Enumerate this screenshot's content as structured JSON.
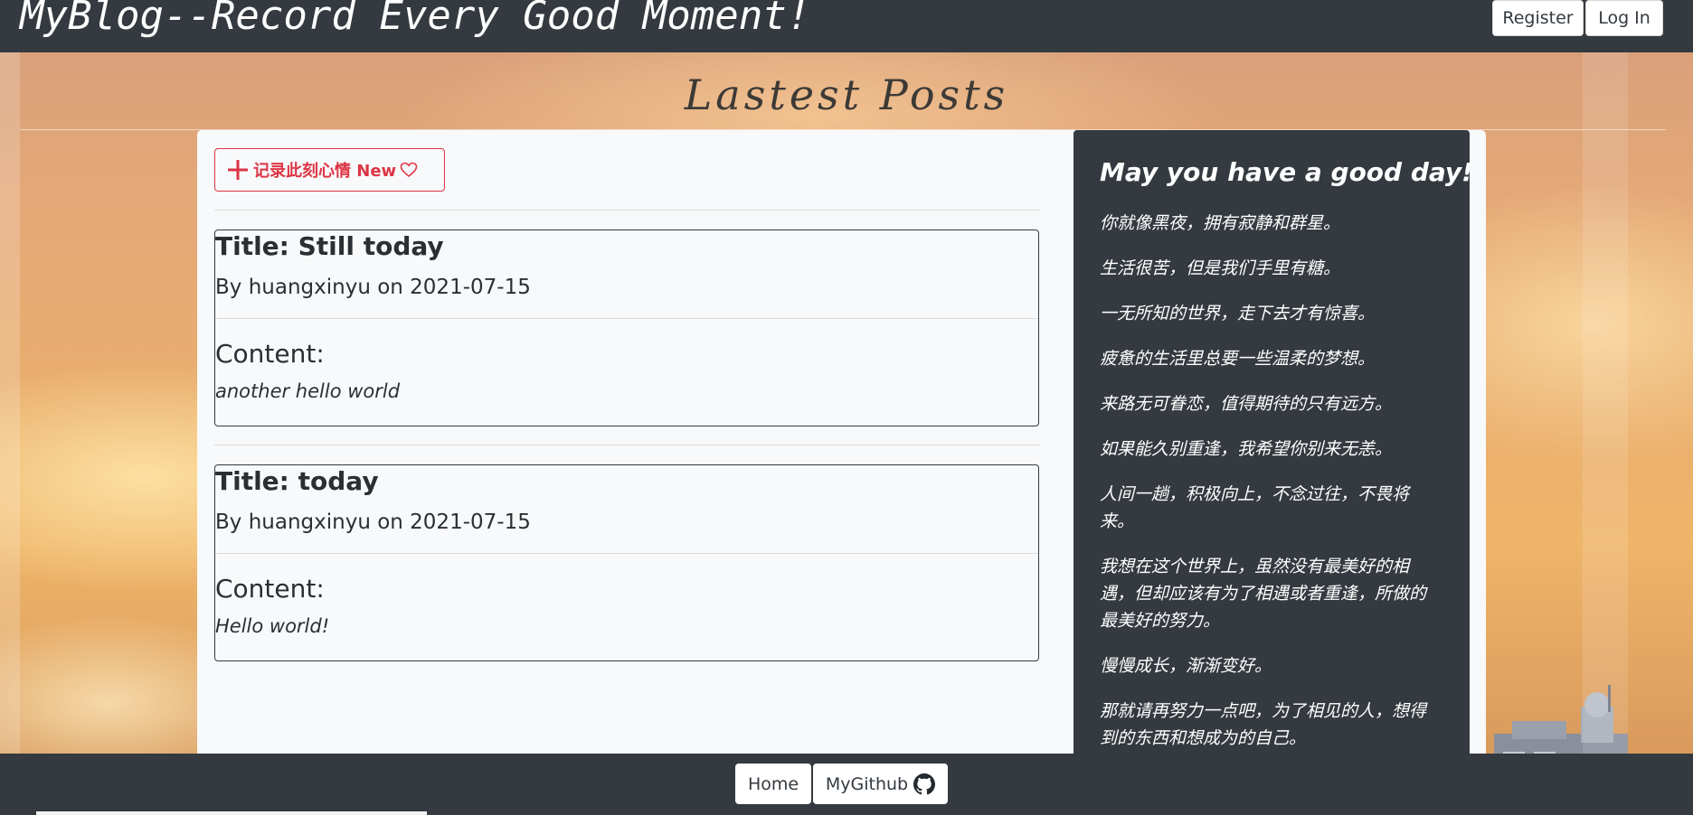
{
  "header": {
    "site_title": "MyBlog--Record Every Good Moment!",
    "register_label": "Register",
    "login_label": "Log In"
  },
  "main": {
    "heading": "Lastest Posts",
    "new_button_label": "记录此刻心情 New",
    "posts": [
      {
        "title": "Title: Still today",
        "meta": "By huangxinyu on 2021-07-15",
        "content_label": "Content:",
        "content": "another hello world"
      },
      {
        "title": "Title: today",
        "meta": "By huangxinyu on 2021-07-15",
        "content_label": "Content:",
        "content": "Hello world!"
      }
    ]
  },
  "sidebar": {
    "title": "May you have a good day!",
    "quotes": [
      "你就像黑夜，拥有寂静和群星。",
      "生活很苦，但是我们手里有糖。",
      "一无所知的世界，走下去才有惊喜。",
      "疲惫的生活里总要一些温柔的梦想。",
      "来路无可眷恋，值得期待的只有远方。",
      "如果能久别重逢，我希望你别来无恙。",
      "人间一趟，积极向上，不念过往，不畏将来。",
      "我想在这个世界上，虽然没有最美好的相遇，但却应该有为了相遇或者重逢，所做的最美好的努力。",
      "慢慢成长，渐渐变好。",
      "那就请再努力一点吧，为了相见的人，想得到的东西和想成为的自己。"
    ]
  },
  "footer": {
    "home_label": "Home",
    "github_label": "MyGithub"
  },
  "colors": {
    "dark": "#343a40",
    "danger": "#dc3545",
    "card": "#f8f9fa"
  }
}
